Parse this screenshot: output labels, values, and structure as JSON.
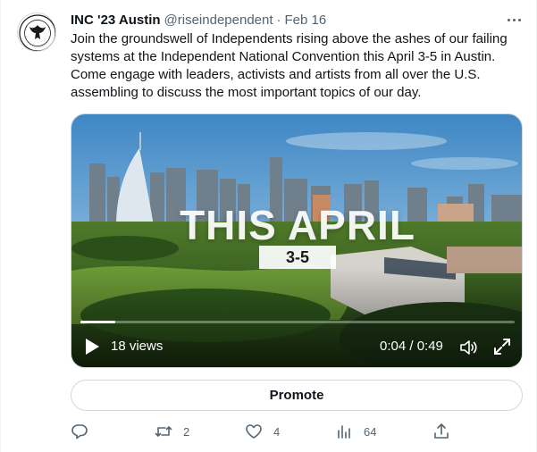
{
  "tweet": {
    "display_name": "INC '23 Austin",
    "handle": "@riseindependent",
    "separator": "·",
    "date": "Feb 16",
    "text_lines": [
      "Join the groundswell of Independents rising above the ashes of our failing",
      "systems at the Independent National Convention this April 3-5 in Austin.",
      "Come engage with leaders, activists and artists from all over the U.S.",
      "assembling to discuss the most important topics of our day."
    ]
  },
  "media": {
    "overlay_title": "THIS APRIL",
    "overlay_date": "3-5",
    "views": "18 views",
    "time": "0:04 / 0:49",
    "progress": 0.08
  },
  "promote_label": "Promote",
  "actions": {
    "reply_count": "",
    "retweet_count": "2",
    "like_count": "4",
    "views_count": "64"
  },
  "colors": {
    "text": "#0f1419",
    "secondary": "#536471",
    "border": "#cfd9de"
  },
  "icons": [
    "more-icon",
    "play-icon",
    "volume-icon",
    "fullscreen-icon",
    "reply-icon",
    "retweet-icon",
    "like-icon",
    "analytics-icon",
    "share-icon"
  ]
}
